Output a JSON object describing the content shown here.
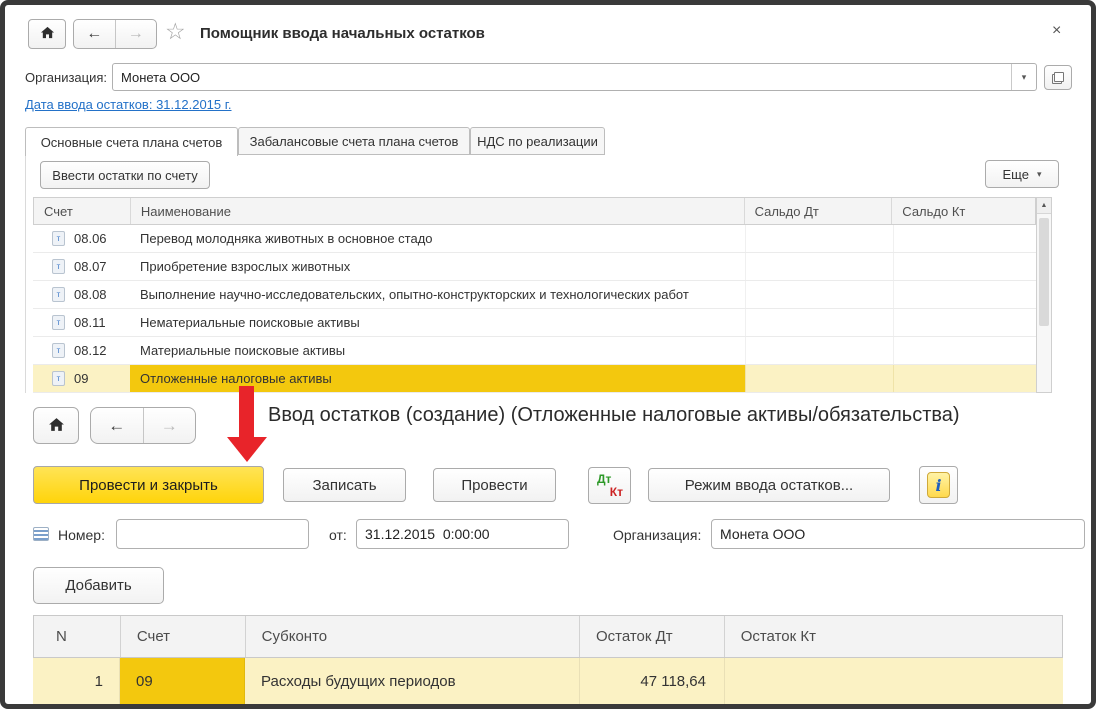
{
  "colors": {
    "selection_strong": "#F3C80E",
    "selection_pale": "#FBF2C4",
    "accent_yellow_button": "#FFD40A",
    "link_blue": "#2371C8",
    "arrow_red": "#E8242A",
    "dt_green": "#2E9929",
    "kt_red": "#CC2222"
  },
  "window1": {
    "title": "Помощник ввода начальных остатков",
    "close_glyph": "×",
    "star_glyph": "☆",
    "nav": {
      "back": "←",
      "forward": "→"
    },
    "org": {
      "label": "Организация:",
      "value": "Монета ООО",
      "caret": "▾"
    },
    "date_link": "Дата ввода остатков: 31.12.2015 г.",
    "tabs": [
      "Основные счета плана счетов",
      "Забалансовые счета плана счетов",
      "НДС по реализации"
    ],
    "active_tab": "Основные счета плана счетов",
    "toolbar": {
      "enter_button": "Ввести остатки по счету",
      "more_button": "Еще",
      "more_caret": "▾"
    },
    "table": {
      "headers": [
        "Счет",
        "Наименование",
        "Сальдо Дт",
        "Сальдо Кт"
      ],
      "scroll_up_glyph": "▲",
      "account_icon_glyph": "т",
      "rows": [
        {
          "account": "08.06",
          "name": "Перевод молодняка животных в основное стадо"
        },
        {
          "account": "08.07",
          "name": "Приобретение взрослых животных"
        },
        {
          "account": "08.08",
          "name": "Выполнение научно-исследовательских, опытно-конструкторских и технологических работ"
        },
        {
          "account": "08.11",
          "name": "Нематериальные поисковые активы"
        },
        {
          "account": "08.12",
          "name": "Материальные поисковые активы"
        },
        {
          "account": "09",
          "name": "Отложенные налоговые активы"
        }
      ],
      "selected_account": "09"
    }
  },
  "window2": {
    "title": "Ввод остатков (создание) (Отложенные налоговые активы/обязательства)",
    "nav": {
      "back": "←",
      "forward": "→"
    },
    "buttons": {
      "post_close": "Провести и закрыть",
      "save": "Записать",
      "post": "Провести",
      "dtkt_dt": "Дт",
      "dtkt_kt": "Кт",
      "mode": "Режим ввода остатков...",
      "info_glyph": "i",
      "add": "Добавить"
    },
    "fields": {
      "number_label": "Номер:",
      "number_value": "",
      "date_label": "от:",
      "date_value": "31.12.2015  0:00:00",
      "org_label": "Организация:",
      "org_value": "Монета ООО"
    },
    "table": {
      "headers": [
        "N",
        "Счет",
        "Субконто",
        "Остаток Дт",
        "Остаток Кт"
      ],
      "rows": [
        {
          "n": "1",
          "account": "09",
          "subconto": "Расходы будущих периодов",
          "balance_dt": "47 118,64",
          "balance_kt": ""
        }
      ]
    }
  }
}
